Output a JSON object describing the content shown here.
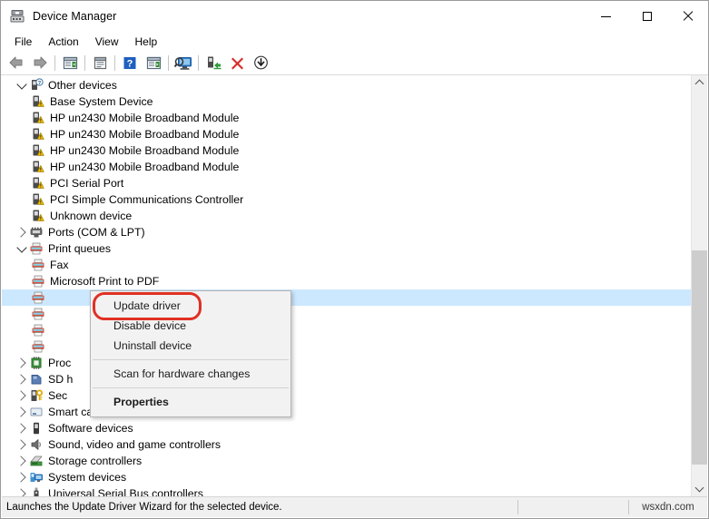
{
  "window": {
    "title": "Device Manager",
    "icon": "device-manager-icon"
  },
  "window_controls": {
    "minimize": "minimize-icon",
    "maximize": "maximize-icon",
    "close": "close-icon"
  },
  "menubar": {
    "items": [
      {
        "label": "File"
      },
      {
        "label": "Action"
      },
      {
        "label": "View"
      },
      {
        "label": "Help"
      }
    ]
  },
  "toolbar": {
    "buttons": [
      {
        "name": "back-icon"
      },
      {
        "name": "forward-icon"
      },
      {
        "name": "show-hide-console-tree-icon"
      },
      {
        "name": "properties-icon"
      },
      {
        "name": "help-icon"
      },
      {
        "name": "show-hide-action-pane-icon"
      },
      {
        "name": "scan-for-hardware-changes-icon"
      },
      {
        "name": "update-driver-icon"
      },
      {
        "name": "uninstall-device-icon"
      },
      {
        "name": "disable-device-icon"
      }
    ]
  },
  "tree": {
    "nodes": [
      {
        "label": "Other devices",
        "level": 0,
        "twisty": "down",
        "icon": "unknown-device-category-icon"
      },
      {
        "label": "Base System Device",
        "level": 1,
        "twisty": "none",
        "icon": "warning-device-icon"
      },
      {
        "label": "HP un2430 Mobile Broadband Module",
        "level": 1,
        "twisty": "none",
        "icon": "warning-device-icon"
      },
      {
        "label": "HP un2430 Mobile Broadband Module",
        "level": 1,
        "twisty": "none",
        "icon": "warning-device-icon"
      },
      {
        "label": "HP un2430 Mobile Broadband Module",
        "level": 1,
        "twisty": "none",
        "icon": "warning-device-icon"
      },
      {
        "label": "HP un2430 Mobile Broadband Module",
        "level": 1,
        "twisty": "none",
        "icon": "warning-device-icon"
      },
      {
        "label": "PCI Serial Port",
        "level": 1,
        "twisty": "none",
        "icon": "warning-device-icon"
      },
      {
        "label": "PCI Simple Communications Controller",
        "level": 1,
        "twisty": "none",
        "icon": "warning-device-icon"
      },
      {
        "label": "Unknown device",
        "level": 1,
        "twisty": "none",
        "icon": "warning-device-icon"
      },
      {
        "label": "Ports (COM & LPT)",
        "level": 0,
        "twisty": "right",
        "icon": "ports-icon"
      },
      {
        "label": "Print queues",
        "level": 0,
        "twisty": "down",
        "icon": "printer-icon"
      },
      {
        "label": "Fax",
        "level": 1,
        "twisty": "none",
        "icon": "printer-icon"
      },
      {
        "label": "Microsoft Print to PDF",
        "level": 1,
        "twisty": "none",
        "icon": "printer-icon"
      },
      {
        "label": "",
        "level": 1,
        "twisty": "none",
        "icon": "printer-icon",
        "selected": true
      },
      {
        "label": "",
        "level": 1,
        "twisty": "none",
        "icon": "printer-icon"
      },
      {
        "label": "",
        "level": 1,
        "twisty": "none",
        "icon": "printer-icon"
      },
      {
        "label": "",
        "level": 1,
        "twisty": "none",
        "icon": "printer-icon"
      },
      {
        "label": "Proc",
        "level": 0,
        "twisty": "right",
        "icon": "processor-icon"
      },
      {
        "label": "SD h",
        "level": 0,
        "twisty": "right",
        "icon": "sd-host-adapter-icon"
      },
      {
        "label": "Sec",
        "level": 0,
        "twisty": "right",
        "icon": "security-device-icon"
      },
      {
        "label": "Smart card readers",
        "level": 0,
        "twisty": "right",
        "icon": "smart-card-reader-icon"
      },
      {
        "label": "Software devices",
        "level": 0,
        "twisty": "right",
        "icon": "software-device-icon"
      },
      {
        "label": "Sound, video and game controllers",
        "level": 0,
        "twisty": "right",
        "icon": "sound-controller-icon"
      },
      {
        "label": "Storage controllers",
        "level": 0,
        "twisty": "right",
        "icon": "storage-controller-icon"
      },
      {
        "label": "System devices",
        "level": 0,
        "twisty": "right",
        "icon": "system-device-icon"
      },
      {
        "label": "Universal Serial Bus controllers",
        "level": 0,
        "twisty": "right",
        "icon": "usb-controller-icon"
      }
    ]
  },
  "context_menu": {
    "items": [
      {
        "label": "Update driver",
        "highlighted": true
      },
      {
        "label": "Disable device"
      },
      {
        "label": "Uninstall device"
      },
      {
        "separator": true
      },
      {
        "label": "Scan for hardware changes"
      },
      {
        "separator": true
      },
      {
        "label": "Properties",
        "bold": true
      }
    ],
    "highlight_color": "#e03024"
  },
  "statusbar": {
    "message": "Launches the Update Driver Wizard for the selected device.",
    "middle": "",
    "watermark": "wsxdn.com"
  },
  "scrollbar": {
    "up_arrow": "scroll-up-icon",
    "down_arrow": "scroll-down-icon"
  }
}
